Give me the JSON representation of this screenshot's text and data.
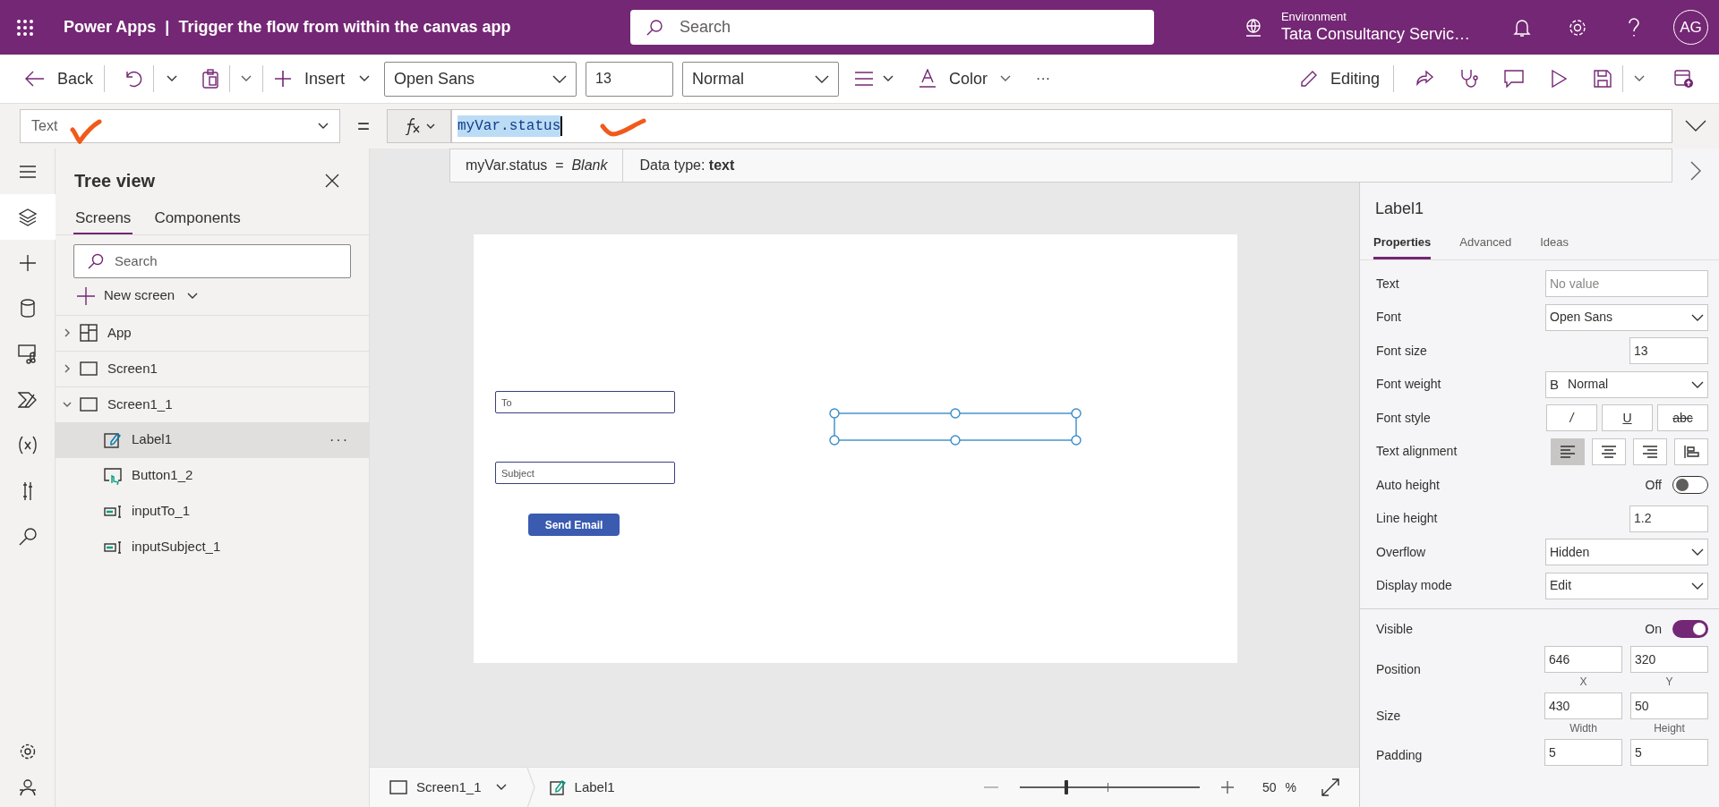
{
  "app_bar": {
    "app_name": "Power Apps",
    "separator": "|",
    "title": "Trigger the flow from within the canvas app",
    "search_placeholder": "Search",
    "environment_label": "Environment",
    "environment_name": "Tata Consultancy Servic…",
    "avatar_initials": "AG"
  },
  "toolbar": {
    "back": "Back",
    "insert": "Insert",
    "font": "Open Sans",
    "font_size": "13",
    "font_weight": "Normal",
    "color_label": "Color",
    "more": "···",
    "editing": "Editing"
  },
  "formula_bar": {
    "property": "Text",
    "equals": "=",
    "formula": "myVar.status",
    "text_selected": true,
    "hint_expression": "myVar.status  =  *Blank*",
    "hint_type": "Data type: **text**"
  },
  "left_rail": [
    {
      "kind": "menu",
      "selected": false
    },
    {
      "kind": "layers",
      "selected": true
    },
    {
      "kind": "insert",
      "selected": false
    },
    {
      "kind": "data",
      "selected": false
    },
    {
      "kind": "media",
      "selected": false
    },
    {
      "kind": "automate",
      "selected": false
    },
    {
      "kind": "variables",
      "selected": false
    },
    {
      "kind": "tools",
      "selected": false
    },
    {
      "kind": "search",
      "selected": false
    }
  ],
  "tree_view": {
    "title": "Tree view",
    "tabs": [
      {
        "label": "Screens",
        "selected": true
      },
      {
        "label": "Components",
        "selected": false
      }
    ],
    "search_placeholder": "Search",
    "new_screen": "New screen",
    "items": [
      {
        "label": "App",
        "kind": "app",
        "expanded": false,
        "selected": false
      },
      {
        "label": "Screen1",
        "kind": "screen",
        "expanded": false,
        "selected": false
      },
      {
        "label": "Screen1_1",
        "kind": "screen",
        "expanded": true,
        "selected": false,
        "children": [
          {
            "label": "Label1",
            "kind": "label",
            "selected": true,
            "actions": "···"
          },
          {
            "label": "Button1_2",
            "kind": "button",
            "selected": false
          },
          {
            "label": "inputTo_1",
            "kind": "input",
            "selected": false
          },
          {
            "label": "inputSubject_1",
            "kind": "input",
            "selected": false
          }
        ]
      }
    ]
  },
  "canvas": {
    "fields": [
      {
        "placeholder": "To"
      },
      {
        "placeholder": "Subject"
      }
    ],
    "button": "Send Email"
  },
  "properties_panel": {
    "control_name": "Label1",
    "tabs": [
      {
        "label": "Properties",
        "selected": true
      },
      {
        "label": "Advanced",
        "selected": false
      },
      {
        "label": "Ideas",
        "selected": false
      }
    ],
    "rows": [
      {
        "kind": "field",
        "label": "Text",
        "placeholder": "No value"
      },
      {
        "kind": "dropdown",
        "label": "Font",
        "value": "Open Sans"
      },
      {
        "kind": "number",
        "label": "Font size",
        "value": "13"
      },
      {
        "kind": "dropdown",
        "label": "Font weight",
        "prefix": "B",
        "value": "Normal"
      },
      {
        "kind": "style",
        "label": "Font style",
        "options": [
          {
            "glyph": "/"
          },
          {
            "glyph": "U"
          },
          {
            "glyph": "abc"
          }
        ]
      },
      {
        "kind": "align",
        "label": "Text alignment",
        "options": [
          {
            "selected": true
          },
          {
            "selected": false
          },
          {
            "selected": false
          },
          {
            "selected": false
          }
        ]
      },
      {
        "kind": "toggle",
        "label": "Auto height",
        "state_text": "Off",
        "on": false
      },
      {
        "kind": "number",
        "label": "Line height",
        "value": "1.2"
      },
      {
        "kind": "dropdown",
        "label": "Overflow",
        "value": "Hidden"
      },
      {
        "kind": "dropdown",
        "label": "Display mode",
        "value": "Edit"
      }
    ],
    "rows_2": [
      {
        "kind": "toggle",
        "label": "Visible",
        "state_text": "On",
        "on": true
      },
      {
        "kind": "pair",
        "label": "Position",
        "values": [
          {
            "value": "646",
            "caption": "X"
          },
          {
            "value": "320",
            "caption": "Y"
          }
        ]
      },
      {
        "kind": "pair",
        "label": "Size",
        "values": [
          {
            "value": "430",
            "caption": "Width"
          },
          {
            "value": "50",
            "caption": "Height"
          }
        ]
      },
      {
        "kind": "pair",
        "label": "Padding",
        "values": [
          {
            "value": "5"
          },
          {
            "value": "5"
          }
        ]
      }
    ]
  },
  "status_bar": {
    "screen": "Screen1_1",
    "control": "Label1",
    "zoom_slider": {
      "level": 0.26
    },
    "zoom_value": "50",
    "zoom_unit": "%"
  }
}
